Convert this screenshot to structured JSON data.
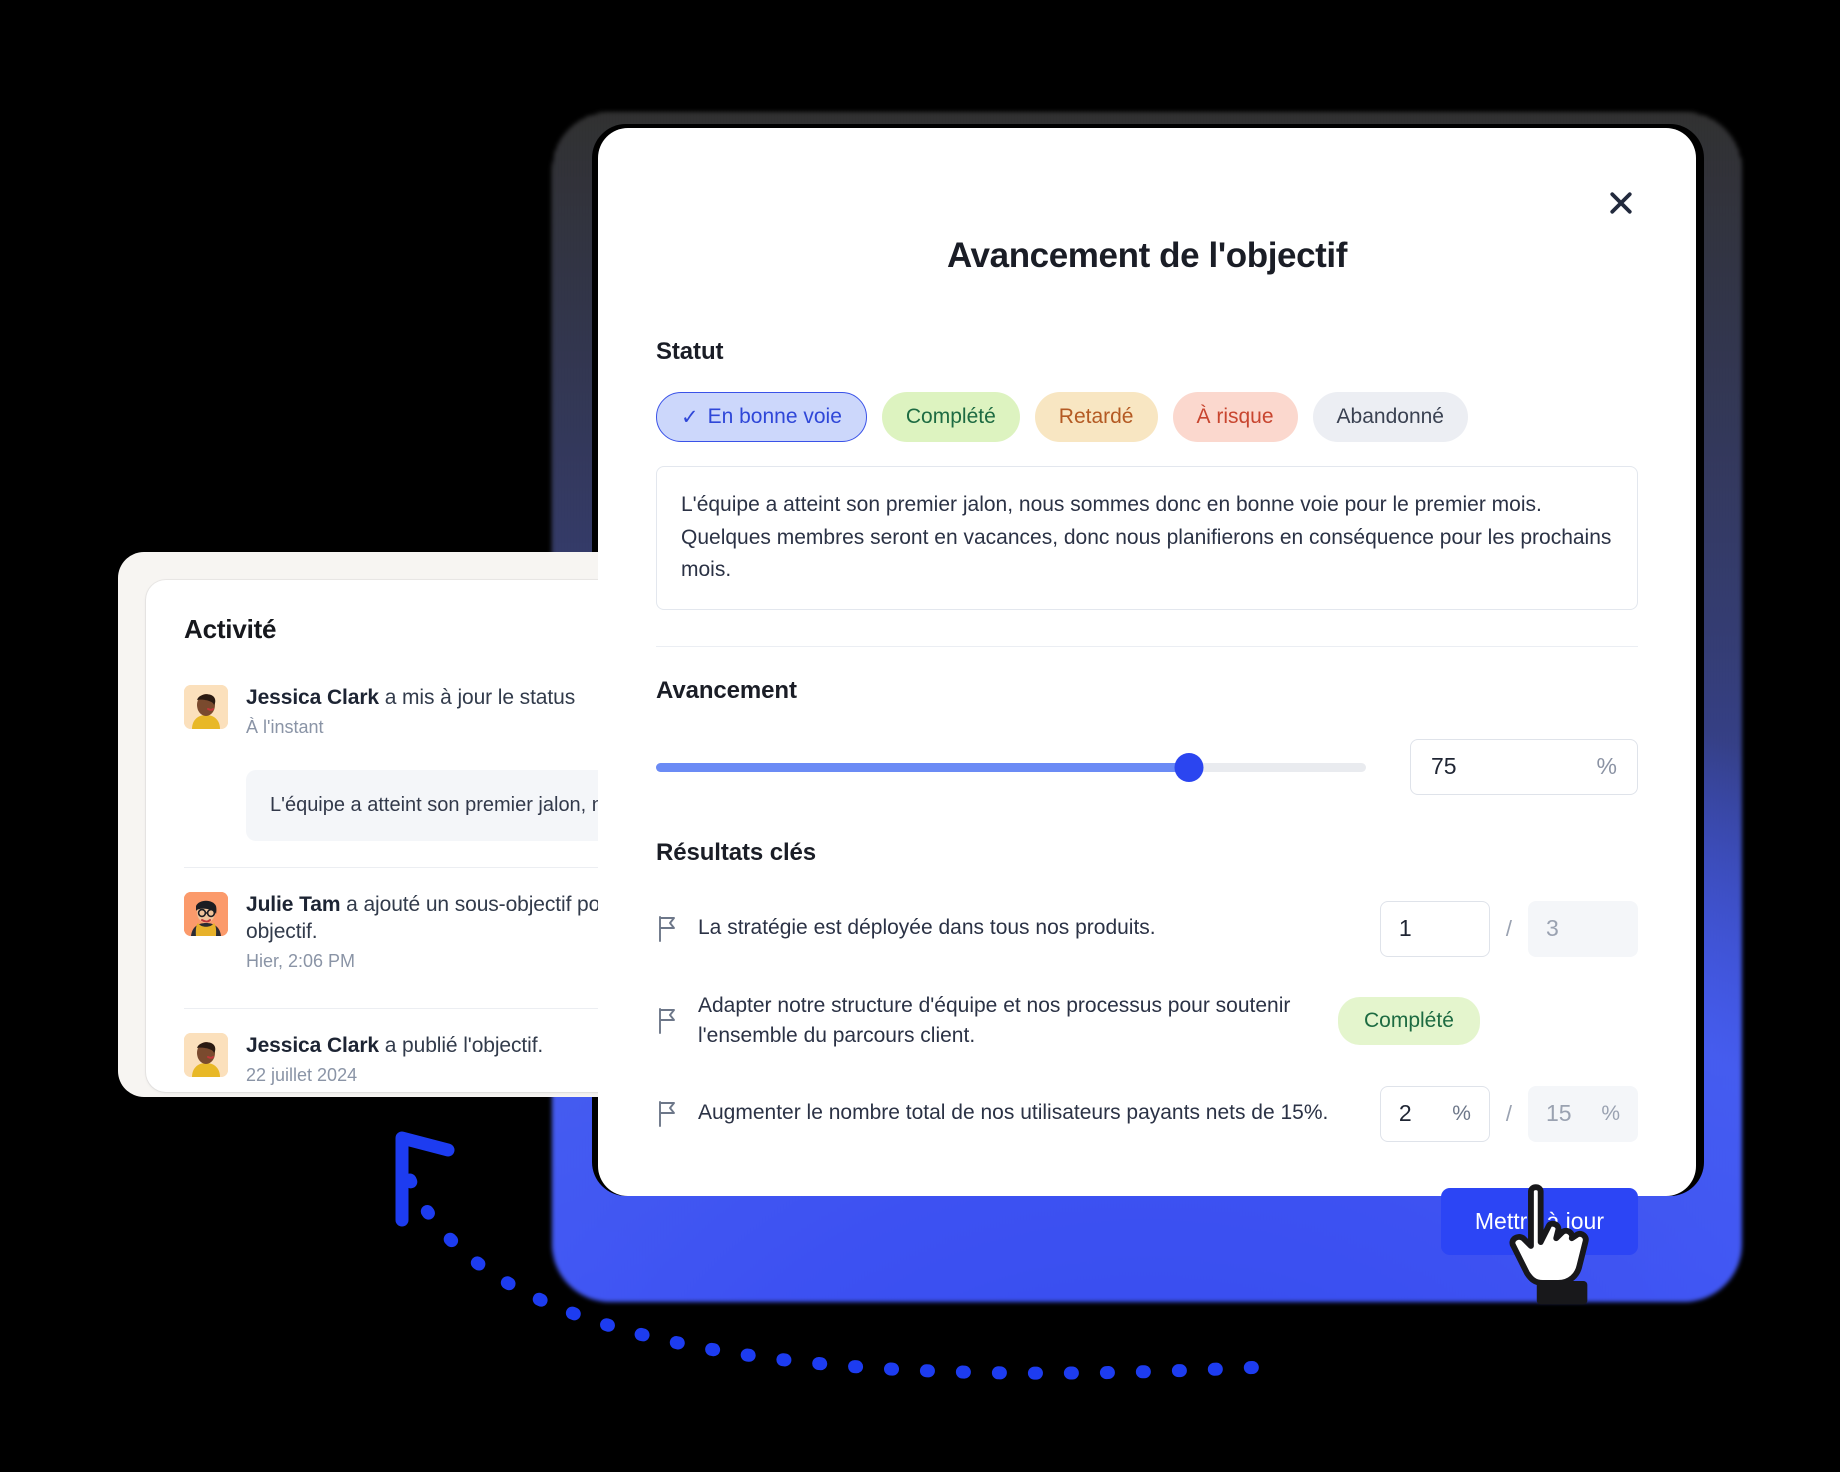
{
  "activity": {
    "title": "Activité",
    "items": [
      {
        "name": "Jessica Clark",
        "action": " a mis à jour le status",
        "time": "À l'instant",
        "quote": "L'équipe a atteint son premier jalon, nous sommes donc en bonne voie pour le premier mois. Quelques membres seront en vacances, donc nous planifierons en conséquence pour les prochains mois."
      },
      {
        "name": "Julie Tam",
        "action": " a ajouté un sous-objectif pour cet objectif.",
        "time": "Hier, 2:06 PM",
        "quote": ""
      },
      {
        "name": "Jessica Clark",
        "action": " a publié l'objectif.",
        "time": "22 juillet 2024",
        "quote": ""
      }
    ]
  },
  "modal": {
    "title": "Avancement de l'objectif",
    "close_icon": "close-icon",
    "status": {
      "label": "Statut",
      "options": [
        {
          "label": "En bonne voie",
          "selected": true,
          "bg": "#ccd7fb",
          "fg": "#2f47d8",
          "check": "✓"
        },
        {
          "label": "Complété",
          "selected": false,
          "bg": "#ddf3c0",
          "fg": "#1d6b42",
          "check": ""
        },
        {
          "label": "Retardé",
          "selected": false,
          "bg": "#f8e6c2",
          "fg": "#b45a23",
          "check": ""
        },
        {
          "label": "À risque",
          "selected": false,
          "bg": "#fbd8ce",
          "fg": "#c8452f",
          "check": ""
        },
        {
          "label": "Abandonné",
          "selected": false,
          "bg": "#eceef3",
          "fg": "#3b4252",
          "check": ""
        }
      ],
      "note": "L'équipe a atteint son premier jalon, nous sommes donc en bonne voie pour le premier mois. Quelques membres seront en vacances, donc nous planifierons en conséquence pour les prochains mois."
    },
    "progress": {
      "label": "Avancement",
      "value": 75,
      "value_text": "75",
      "unit": "%",
      "min": 0,
      "max": 100,
      "fill_color": "#6b8bf5",
      "knob_color": "#2b45f0"
    },
    "key_results": {
      "label": "Résultats clés",
      "separator": "/",
      "items": [
        {
          "icon": "flag-icon",
          "text": "La stratégie est déployée dans tous nos produits.",
          "type": "number",
          "current": "1",
          "current_unit": "",
          "target": "3",
          "target_unit": "",
          "badge": ""
        },
        {
          "icon": "flag-icon",
          "text": "Adapter notre structure d'équipe et nos processus pour soutenir l'ensemble du parcours client.",
          "type": "badge",
          "current": "",
          "current_unit": "",
          "target": "",
          "target_unit": "",
          "badge": "Complété"
        },
        {
          "icon": "flag-icon",
          "text": "Augmenter le nombre total de nos utilisateurs payants nets de 15%.",
          "type": "percent",
          "current": "2",
          "current_unit": "%",
          "target": "15",
          "target_unit": "%",
          "badge": ""
        }
      ]
    },
    "submit_label": "Mettre à jour",
    "accent_color": "#2c45f5"
  },
  "cursor": {
    "icon": "pointing-hand-cursor"
  },
  "annotation": {
    "icon": "dotted-curved-arrow"
  }
}
